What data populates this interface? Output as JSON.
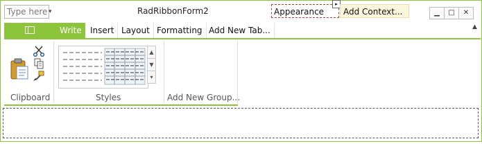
{
  "title_bar": {
    "qat_input_placeholder": "Type here",
    "qat_dropdown_glyph": "▾",
    "form_title": "RadRibbonForm2",
    "context_groups": [
      "Appearance",
      "Add Context..."
    ],
    "context_arrow_glyph": "▸",
    "window_buttons": [
      "minimize-icon",
      "maximize-icon",
      "close-icon"
    ],
    "window_glyphs": [
      "▁",
      "□",
      "✕"
    ]
  },
  "tabs": [
    {
      "label": "Write",
      "active": true
    },
    {
      "label": "Insert",
      "active": false
    },
    {
      "label": "Layout",
      "active": false
    },
    {
      "label": "Formatting",
      "active": false
    },
    {
      "label": "Add New Tab...",
      "active": false
    }
  ],
  "ribbon": {
    "collapse_glyph": "▲",
    "groups": [
      {
        "label": "Clipboard",
        "icons": [
          "paste-icon",
          "cut-icon",
          "copy-icon",
          "format-painter-icon"
        ]
      },
      {
        "label": "Styles",
        "gallery_buttons": [
          "▲",
          "▼",
          "▾"
        ]
      },
      {
        "label": "Add New Group..."
      }
    ]
  },
  "colors": {
    "accent": "#8cc43c",
    "context_highlight": "#fbf7dc",
    "selection_dash": "#c0392b"
  }
}
